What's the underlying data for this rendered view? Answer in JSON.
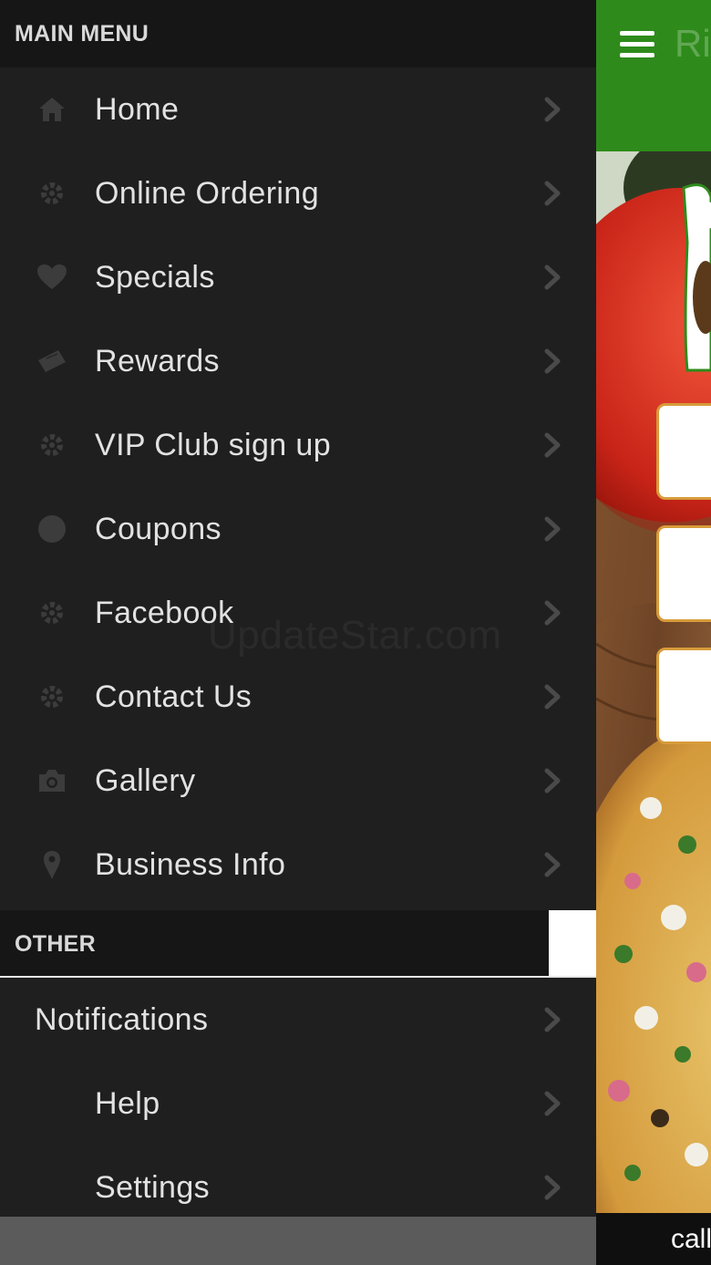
{
  "drawer": {
    "main_header": "MAIN MENU",
    "other_header": "OTHER",
    "main_items": [
      {
        "label": "Home",
        "icon": "home-icon"
      },
      {
        "label": "Online Ordering",
        "icon": "cog-icon"
      },
      {
        "label": "Specials",
        "icon": "heart-icon"
      },
      {
        "label": "Rewards",
        "icon": "ticket-icon"
      },
      {
        "label": "VIP Club sign up",
        "icon": "cog-icon"
      },
      {
        "label": "Coupons",
        "icon": "circle-icon"
      },
      {
        "label": "Facebook",
        "icon": "cog-icon"
      },
      {
        "label": "Contact Us",
        "icon": "cog-icon"
      },
      {
        "label": "Gallery",
        "icon": "camera-icon"
      },
      {
        "label": "Business Info",
        "icon": "map-pin-icon"
      }
    ],
    "other_items": [
      {
        "label": "Notifications"
      },
      {
        "label": "Help"
      },
      {
        "label": "Settings"
      }
    ],
    "watermark": "UpdateStar.com"
  },
  "app": {
    "title": "Ri",
    "footer_text": "call",
    "header_color": "#2e8b1b",
    "tile_border_color": "#d79b3a"
  },
  "colors": {
    "drawer_bg": "#1f1f1f",
    "header_bg": "#161616",
    "text": "#e2e2e2",
    "icon": "#3c3c3c",
    "chevron": "#4a4a4a"
  }
}
